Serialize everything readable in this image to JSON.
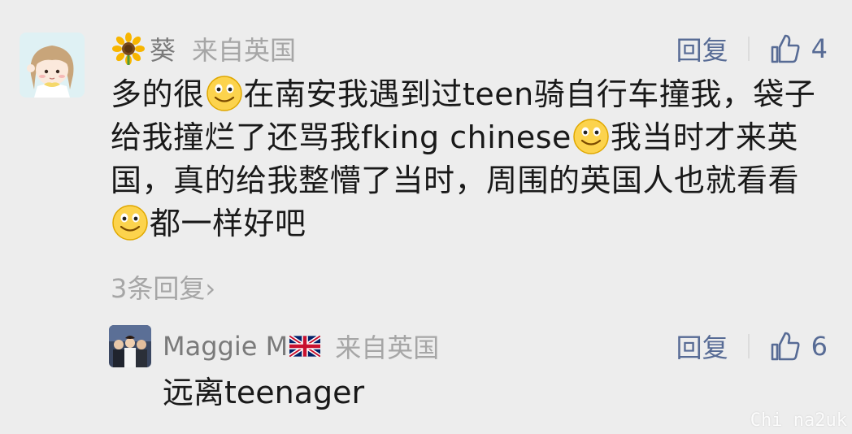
{
  "comment": {
    "username": "葵",
    "location": "来自英国",
    "reply_label": "回复",
    "like_count": "4",
    "text": {
      "p1": "多的很",
      "p2": "在南安我遇到过teen骑自行车撞我，袋子给我撞烂了还骂我fking chinese",
      "p3": "我当时才来英国，真的给我整懵了当时，周围的英国人也就看看",
      "p4": "都一样好吧"
    },
    "reply_count_label": "3条回复",
    "reply_count_chevron": "›"
  },
  "reply": {
    "username": "Maggie M",
    "location": "来自英国",
    "reply_label": "回复",
    "like_count": "6",
    "text": "远离teenager"
  },
  "watermark": "Chi na2uk",
  "icons": {
    "flower": "sunflower-emoji",
    "smiley": "smiley-emoji",
    "thumb": "thumbs-up-icon",
    "flag": "uk-flag-emoji"
  },
  "colors": {
    "background": "#ededed",
    "link": "#576b95",
    "muted": "#a6a6a6",
    "text": "#191919"
  }
}
